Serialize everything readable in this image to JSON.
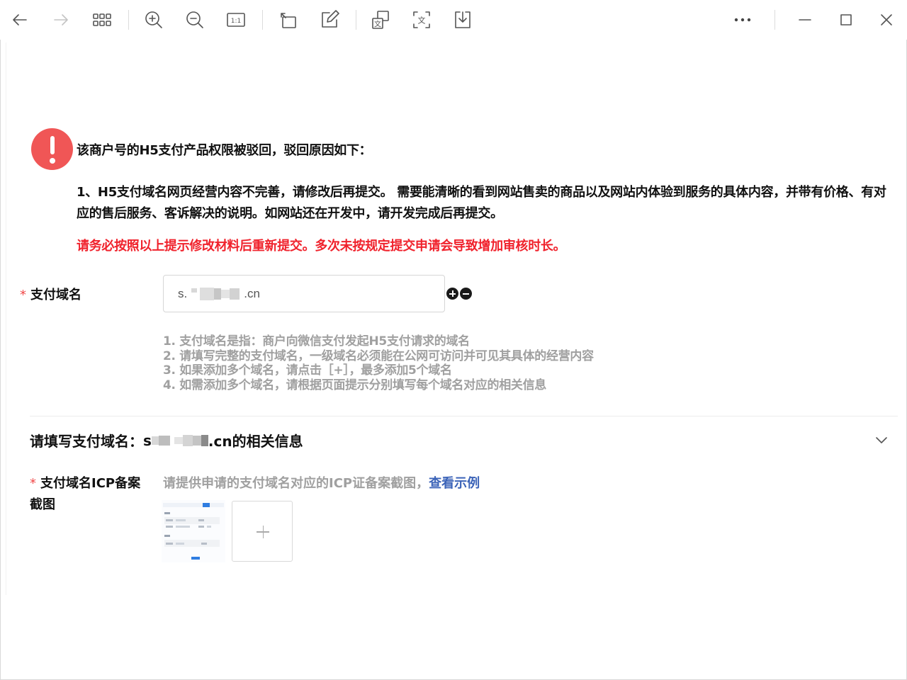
{
  "toolbar": {
    "icons": [
      "back-arrow-icon",
      "forward-arrow-icon",
      "grid-view-icon",
      "zoom-in-icon",
      "zoom-out-icon",
      "actual-size-icon",
      "rotate-icon",
      "edit-icon",
      "translate-icon",
      "ocr-text-icon",
      "download-icon",
      "more-icon",
      "minimize-icon",
      "maximize-icon",
      "close-icon"
    ],
    "actual_size_label": "1:1",
    "translate_label": "文",
    "ocr_label": "文"
  },
  "alert": {
    "title": "该商户号的H5支付产品权限被驳回，驳回原因如下：",
    "reason": "1、H5支付域名网页经营内容不完善，请修改后再提交。 需要能清晰的看到网站售卖的商品以及网站内体验到服务的具体内容，并带有价格、有对应的售后服务、客诉解决的说明。如网站还在开发中，请开发完成后再提交。",
    "warning": "请务必按照以上提示修改材料后重新提交。多次未按规定提交申请会导致增加审核时长。",
    "accent": "#f05656",
    "warning_color": "#f0222c"
  },
  "form": {
    "required_mark": "*",
    "domain_label": "支付域名",
    "domain_prefix": "s.",
    "domain_suffix": ".cn",
    "hints": [
      "1. 支付域名是指：商户向微信支付发起H5支付请求的域名",
      "2. 请填写完整的支付域名，一级域名必须能在公网可访问并可见其具体的经营内容",
      "3. 如果添加多个域名，请点击［+］，最多添加5个域名",
      "4. 如需添加多个域名，请根据页面提示分别填写每个域名对应的相关信息"
    ]
  },
  "section": {
    "title_prefix": "请填写支付域名：",
    "title_domain_start": "s",
    "title_suffix": ".cn的相关信息",
    "icp_label_line1": "支付域名ICP备案",
    "icp_label_line2": "截图",
    "icp_hint": "请提供申请的支付域名对应的ICP证备案截图，",
    "view_example": "查看示例",
    "link_color": "#3b63b8"
  }
}
